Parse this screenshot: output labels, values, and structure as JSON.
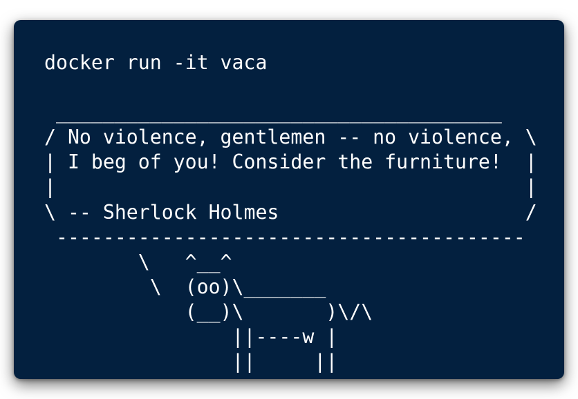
{
  "terminal": {
    "background": "#03203f",
    "text_color": "#ffffff",
    "command": "docker run -it vaca",
    "output_lines": [
      "",
      " ______________________________________",
      "/ No violence, gentlemen -- no violence, \\",
      "| I beg of you! Consider the furniture!  |",
      "|                                        |",
      "\\ -- Sherlock Holmes                     /",
      " ----------------------------------------",
      "        \\   ^__^",
      "         \\  (oo)\\_______",
      "            (__)\\       )\\/\\",
      "                ||----w |",
      "                ||     ||"
    ]
  }
}
